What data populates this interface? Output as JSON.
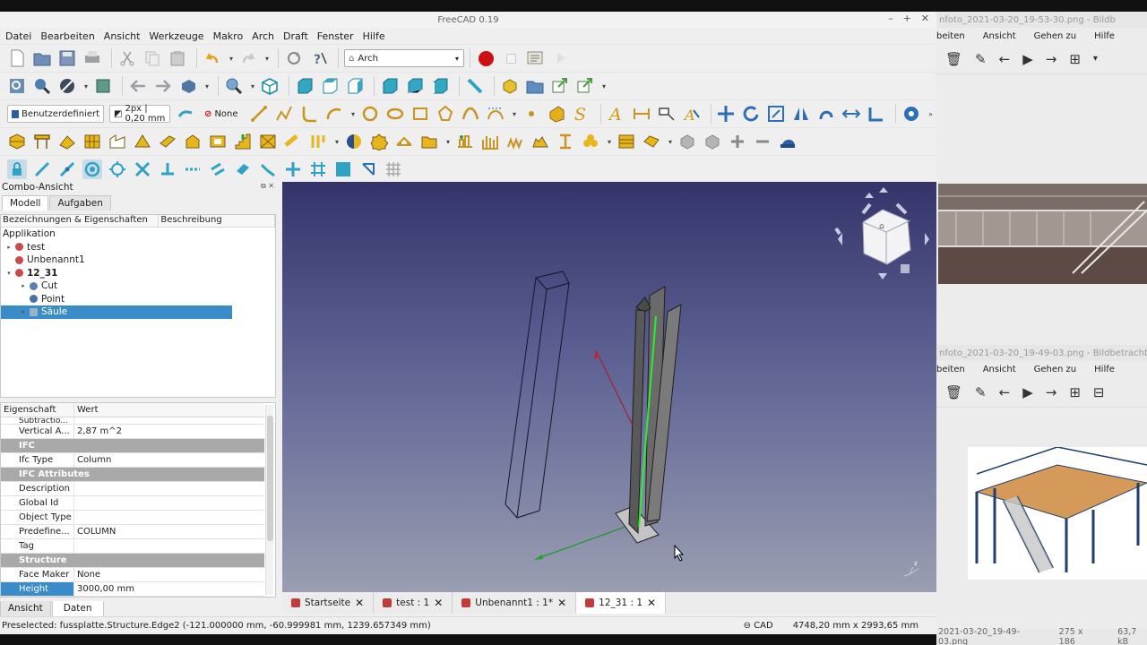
{
  "window": {
    "title": "FreeCAD 0.19"
  },
  "menu": [
    "Datei",
    "Bearbeiten",
    "Ansicht",
    "Werkzeuge",
    "Makro",
    "Arch",
    "Draft",
    "Fenster",
    "Hilfe"
  ],
  "toolbar": {
    "workbench": "Arch",
    "style_preset": "Benutzerdefiniert",
    "line_style": "2px | 0,20 mm",
    "annotation_style": "None"
  },
  "combo": {
    "title": "Combo-Ansicht",
    "tabs": [
      "Modell",
      "Aufgaben"
    ],
    "columns": [
      "Bezeichnungen & Eigenschaften",
      "Beschreibung"
    ],
    "section": "Applikation",
    "tree": [
      {
        "label": "test",
        "level": 0,
        "icon": "document-icon",
        "color": "#c84a4a",
        "arrow": "▸"
      },
      {
        "label": "Unbenannt1",
        "level": 0,
        "icon": "document-icon",
        "color": "#c84a4a",
        "arrow": ""
      },
      {
        "label": "12_31",
        "level": 0,
        "icon": "document-icon",
        "color": "#c84a4a",
        "arrow": "▾",
        "bold": true
      },
      {
        "label": "Cut",
        "level": 1,
        "icon": "cut-icon",
        "color": "#5a7fb3",
        "arrow": "▸"
      },
      {
        "label": "Point",
        "level": 1,
        "icon": "point-icon",
        "color": "#4a6fa5",
        "arrow": ""
      },
      {
        "label": "Säule",
        "level": 1,
        "icon": "column-icon",
        "color": "#9ab3cc",
        "arrow": "▸",
        "selected": true
      }
    ]
  },
  "properties": {
    "headers": [
      "Eigenschaft",
      "Wert"
    ],
    "rows": [
      {
        "key": "Subtractio...",
        "value": "",
        "type": "cut"
      },
      {
        "key": "Vertical A...",
        "value": "2,87 m^2"
      },
      {
        "key": "IFC",
        "value": "",
        "type": "group"
      },
      {
        "key": "Ifc Type",
        "value": "Column"
      },
      {
        "key": "IFC Attributes",
        "value": "",
        "type": "group"
      },
      {
        "key": "Description",
        "value": ""
      },
      {
        "key": "Global Id",
        "value": ""
      },
      {
        "key": "Object Type",
        "value": ""
      },
      {
        "key": "Predefine...",
        "value": "COLUMN"
      },
      {
        "key": "Tag",
        "value": ""
      },
      {
        "key": "Structure",
        "value": "",
        "type": "group"
      },
      {
        "key": "Face Maker",
        "value": "None"
      },
      {
        "key": "Height",
        "value": "3000,00 mm",
        "type": "highlight"
      }
    ]
  },
  "bottom_tabs": [
    "Ansicht",
    "Daten"
  ],
  "doc_tabs": [
    {
      "label": "Startseite"
    },
    {
      "label": "test : 1"
    },
    {
      "label": "Unbenannt1 : 1*"
    },
    {
      "label": "12_31 : 1",
      "active": true
    }
  ],
  "status": {
    "message": "Preselected: fussplatte.Structure.Edge2 (-121.000000 mm, -60.999981 mm, 1239.657349 mm)",
    "nav_style": "CAD",
    "dimensions": "4748,20 mm x 2993,65 mm"
  },
  "image_viewer_1": {
    "title": "nfoto_2021-03-20_19-53-30.png - Bildb",
    "menu": [
      "beiten",
      "Ansicht",
      "Gehen zu",
      "Hilfe"
    ]
  },
  "image_viewer_2": {
    "title": "nfoto_2021-03-20_19-49-03.png - Bildbetrachter | I",
    "menu": [
      "beiten",
      "Ansicht",
      "Gehen zu",
      "Hilfe"
    ],
    "status_file": "2021-03-20_19-49-03.png",
    "status_dims": "275 x 186",
    "status_size": "63,7 kB"
  },
  "colors": {
    "selection": "#3a8cc9",
    "record": "#cc1111",
    "viewport_top": "#34346a",
    "viewport_bottom": "#9a9eb2"
  }
}
